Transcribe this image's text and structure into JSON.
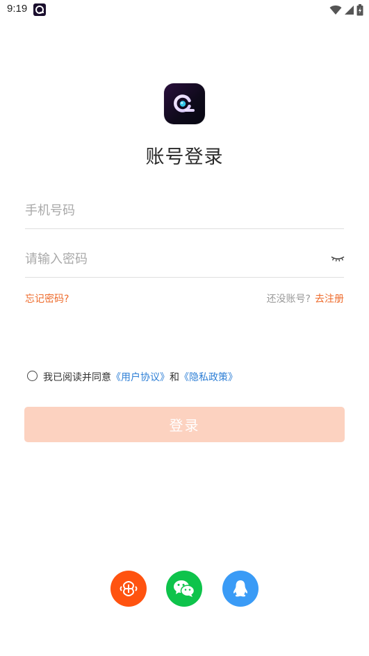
{
  "status_bar": {
    "time": "9:19",
    "icons": [
      "app-notification-icon",
      "wifi-icon",
      "signal-icon",
      "battery-icon"
    ]
  },
  "header": {
    "logo_icon": "app-logo-icon",
    "title": "账号登录"
  },
  "form": {
    "phone_placeholder": "手机号码",
    "phone_value": "",
    "password_placeholder": "请输入密码",
    "password_value": "",
    "password_toggle_icon": "eye-closed-icon",
    "forgot_password": "忘记密码?",
    "no_account": "还没账号?",
    "register": "去注册"
  },
  "agreement": {
    "checked": false,
    "prefix": "我已阅读并同意",
    "user_agreement": "《用户协议》",
    "and": "和",
    "privacy_policy": "《隐私政策》"
  },
  "login_button": {
    "label": "登录",
    "enabled": false
  },
  "social_login": [
    {
      "name": "china-unicom-icon",
      "color": "#ff5310"
    },
    {
      "name": "wechat-icon",
      "color": "#0ec34b"
    },
    {
      "name": "qq-icon",
      "color": "#3a9bf6"
    }
  ],
  "colors": {
    "accent": "#ee6a2a",
    "link_blue": "#2e7fd6",
    "button_disabled": "#fcd2c0"
  }
}
